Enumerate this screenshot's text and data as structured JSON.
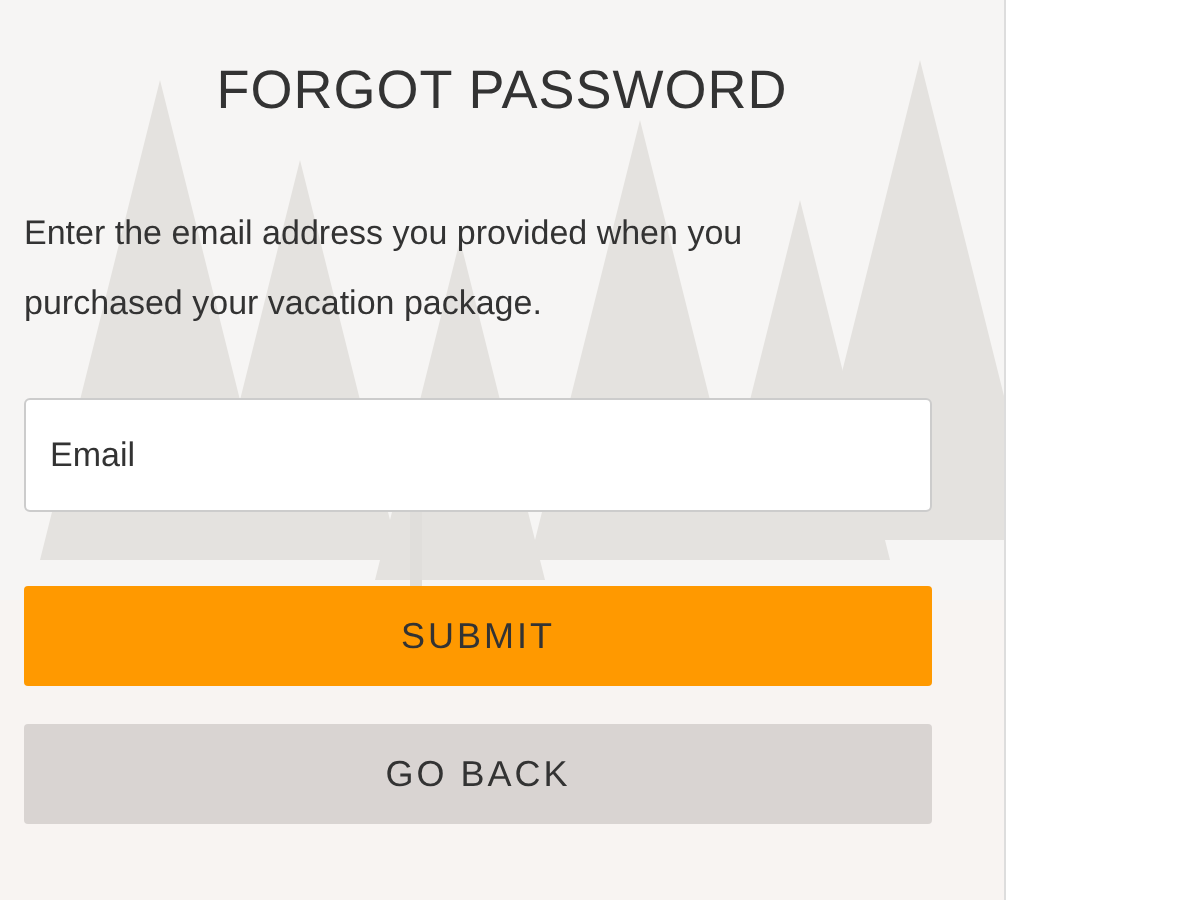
{
  "title": "FORGOT PASSWORD",
  "instructions": "Enter the email address you provided when you purchased your vacation package.",
  "email": {
    "placeholder": "Email"
  },
  "buttons": [
    {
      "label": "SUBMIT",
      "kind": "primary"
    },
    {
      "label": "GO BACK",
      "kind": "secondary"
    }
  ]
}
